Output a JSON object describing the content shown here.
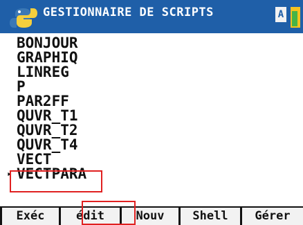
{
  "header": {
    "title": "GESTIONNAIRE DE SCRIPTS",
    "mode_indicator": "A",
    "logo_icon": "python-logo-icon",
    "battery_icon": "battery-icon"
  },
  "scripts": [
    {
      "name": "BONJOUR"
    },
    {
      "name": "GRAPHIQ"
    },
    {
      "name": "LINREG"
    },
    {
      "name": "P"
    },
    {
      "name": "PAR2FF"
    },
    {
      "name": "QUVR_T1"
    },
    {
      "name": "QUVR_T2"
    },
    {
      "name": "QUVR_T4"
    },
    {
      "name": "VECT"
    },
    {
      "name": "VECTPARA",
      "selected": true
    }
  ],
  "selection_marker": "▸",
  "softkeys": [
    {
      "label": "Exéc"
    },
    {
      "label": "édit"
    },
    {
      "label": "Nouv"
    },
    {
      "label": "Shell"
    },
    {
      "label": "Gérer"
    }
  ],
  "colors": {
    "header_background": "#1f5fa8",
    "header_text": "#ffffff",
    "annotation_red": "#e02020",
    "softkey_background": "#f2f2f2",
    "softkey_separator": "#111111"
  }
}
